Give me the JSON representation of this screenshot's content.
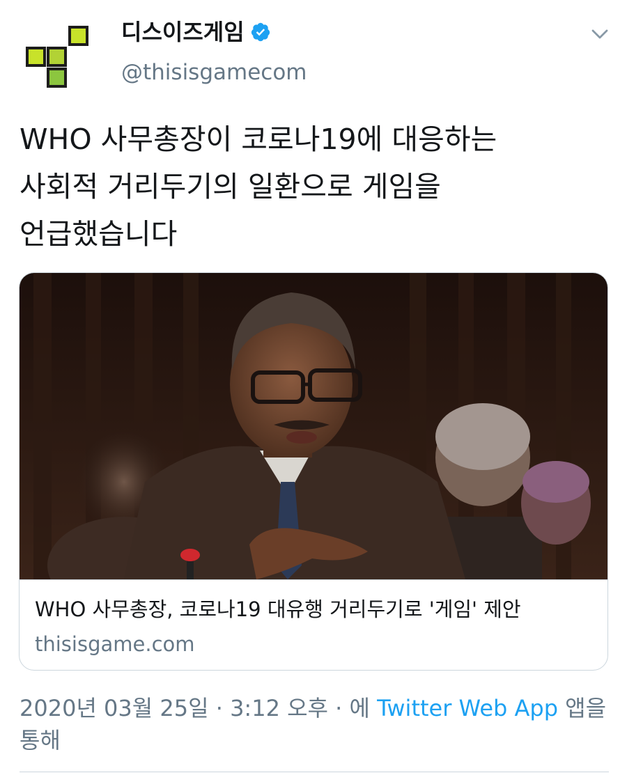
{
  "account": {
    "display_name": "디스이즈게임",
    "handle": "@thisisgamecom",
    "verified": true,
    "avatar_icon": "thisisgame-logo-icon",
    "avatar_colors": [
      "#c8e22a",
      "#8cc63f",
      "#1d1d1b"
    ]
  },
  "menu": {
    "icon": "chevron-down-icon"
  },
  "tweet": {
    "lines": [
      "WHO 사무총장이 코로나19에 대응하는",
      "사회적 거리두기의 일환으로 게임을",
      "언급했습니다"
    ]
  },
  "card": {
    "image_icon": "news-photo",
    "title": "WHO 사무총장, 코로나19 대유행 거리두기로 '게임' 제안",
    "domain": "thisisgame.com"
  },
  "meta": {
    "date": "2020년 03월 25일",
    "sep1": " · ",
    "time": "3:12 오후",
    "sep2": " · ",
    "via_prefix": "에 ",
    "app": "Twitter Web App",
    "via_suffix": " 앱을 통해"
  },
  "colors": {
    "text": "#14171a",
    "muted": "#657786",
    "link": "#1da1f2",
    "border": "#ccd6dd",
    "verified": "#1da1f2"
  }
}
